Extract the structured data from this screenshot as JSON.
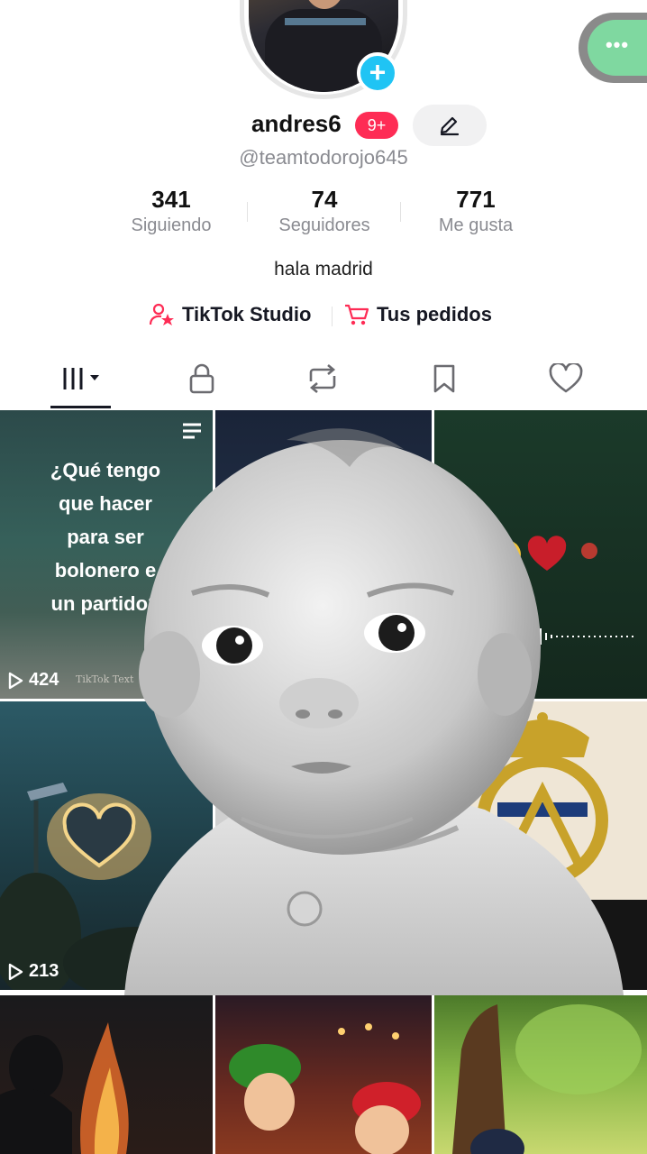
{
  "profile": {
    "username": "andres6",
    "notification_badge": "9+",
    "handle": "@teamtodorojo645",
    "bio": "hala madrid"
  },
  "stats": [
    {
      "value": "341",
      "label": "Siguiendo"
    },
    {
      "value": "74",
      "label": "Seguidores"
    },
    {
      "value": "771",
      "label": "Me gusta"
    }
  ],
  "links": {
    "studio": "TikTok Studio",
    "orders": "Tus pedidos"
  },
  "tabs": [
    "videos-tab",
    "private-tab",
    "reposts-tab",
    "favorites-tab",
    "liked-tab"
  ],
  "grid": {
    "tile1_caption": "¿Qué tengo que hacer para ser bolonero en un partido?",
    "tile1_caption_visible": "¿Qué tengo\nque hacer\npara ser\nbolonero e\nun partido?",
    "tile1_views": "424",
    "tile1_watermark": "TikTok Text",
    "tile4_views": "213"
  },
  "colors": {
    "accent_red": "#fe2c55",
    "accent_cyan": "#20c4f4",
    "text_secondary": "#8a8b91"
  }
}
